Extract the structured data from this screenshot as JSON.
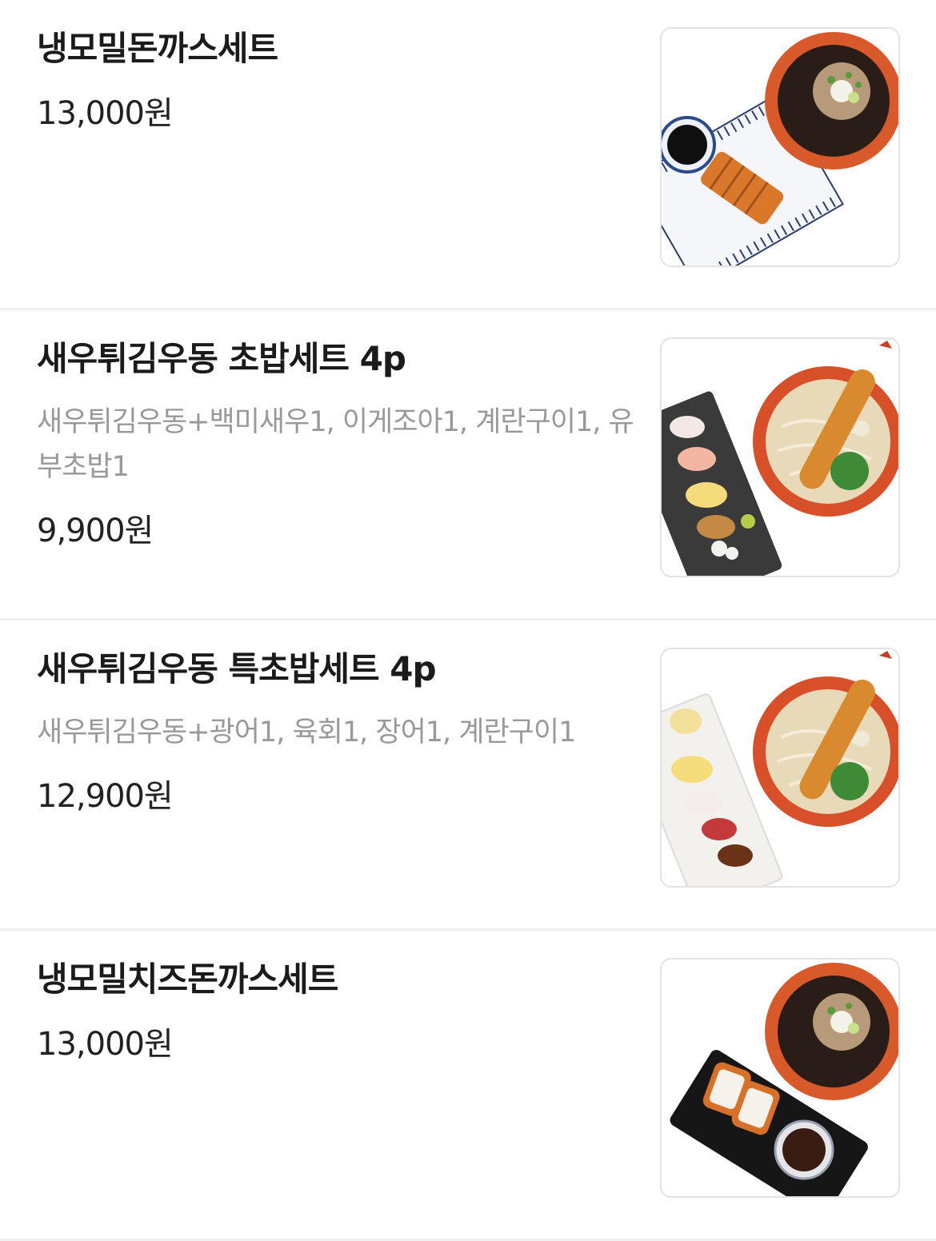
{
  "menu": {
    "items": [
      {
        "name": "냉모밀돈까스세트",
        "description": "",
        "price": "13,000원",
        "image": "soba-tonkatsu-set-photo"
      },
      {
        "name": "새우튀김우동 초밥세트 4p",
        "description": "새우튀김우동+백미새우1, 이게조아1, 계란구이1, 유부초밥1",
        "price": "9,900원",
        "image": "shrimp-udon-sushi-set-photo"
      },
      {
        "name": "새우튀김우동 특초밥세트 4p",
        "description": "새우튀김우동+광어1, 육회1, 장어1, 계란구이1",
        "price": "12,900원",
        "image": "shrimp-udon-special-sushi-set-photo"
      },
      {
        "name": "냉모밀치즈돈까스세트",
        "description": "",
        "price": "13,000원",
        "image": "soba-cheese-tonkatsu-set-photo"
      }
    ]
  }
}
